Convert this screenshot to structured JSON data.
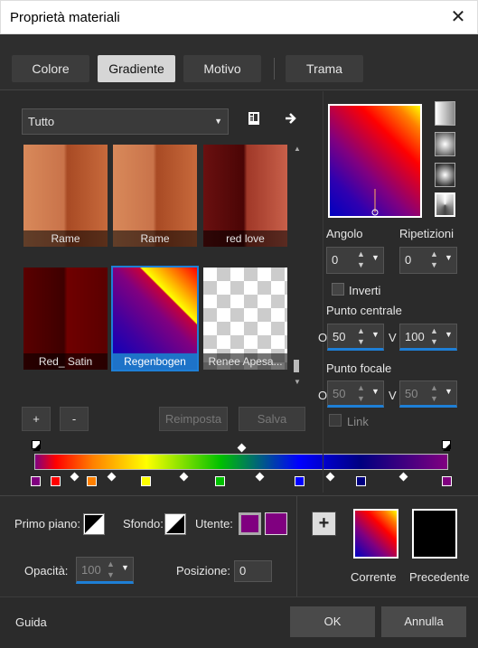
{
  "window": {
    "title": "Proprietà materiali",
    "close_glyph": "✕"
  },
  "tabs": [
    {
      "label": "Colore"
    },
    {
      "label": "Gradiente"
    },
    {
      "label": "Motivo"
    },
    {
      "label": "Trama"
    }
  ],
  "gallery": {
    "category": "Tutto",
    "items": [
      {
        "label": "Rame"
      },
      {
        "label": "Rame"
      },
      {
        "label": "red love"
      },
      {
        "label": "Red_ Satin"
      },
      {
        "label": "Regenbogen"
      },
      {
        "label": "Renee Apesa..."
      }
    ],
    "add_label": "+",
    "remove_label": "-",
    "reset_label": "Reimposta",
    "save_label": "Salva"
  },
  "gradient_settings": {
    "angle_label": "Angolo",
    "angle_value": "0",
    "repeat_label": "Ripetizioni",
    "repeat_value": "0",
    "invert_label": "Inverti",
    "center_label": "Punto centrale",
    "center_h_prefix": "O",
    "center_h": "50",
    "center_v_prefix": "V",
    "center_v": "100",
    "focal_label": "Punto focale",
    "focal_h_prefix": "O",
    "focal_h": "50",
    "focal_v_prefix": "V",
    "focal_v": "50",
    "link_label": "Link"
  },
  "bottom": {
    "fg_label": "Primo piano:",
    "bg_label": "Sfondo:",
    "user_label": "Utente:",
    "user_color": "#800080",
    "opacity_label": "Opacità:",
    "opacity_value": "100",
    "position_label": "Posizione:",
    "position_value": "0",
    "current_label": "Corrente",
    "previous_label": "Precedente",
    "add_glyph": "+"
  },
  "footer": {
    "help_label": "Guida",
    "ok_label": "OK",
    "cancel_label": "Annulla"
  },
  "colors": {
    "accent": "#1e7fd6",
    "gradient_stops": [
      "#800080",
      "#ff0000",
      "#ff8000",
      "#ffff00",
      "#00c000",
      "#0000ff",
      "#000080",
      "#800080"
    ]
  }
}
